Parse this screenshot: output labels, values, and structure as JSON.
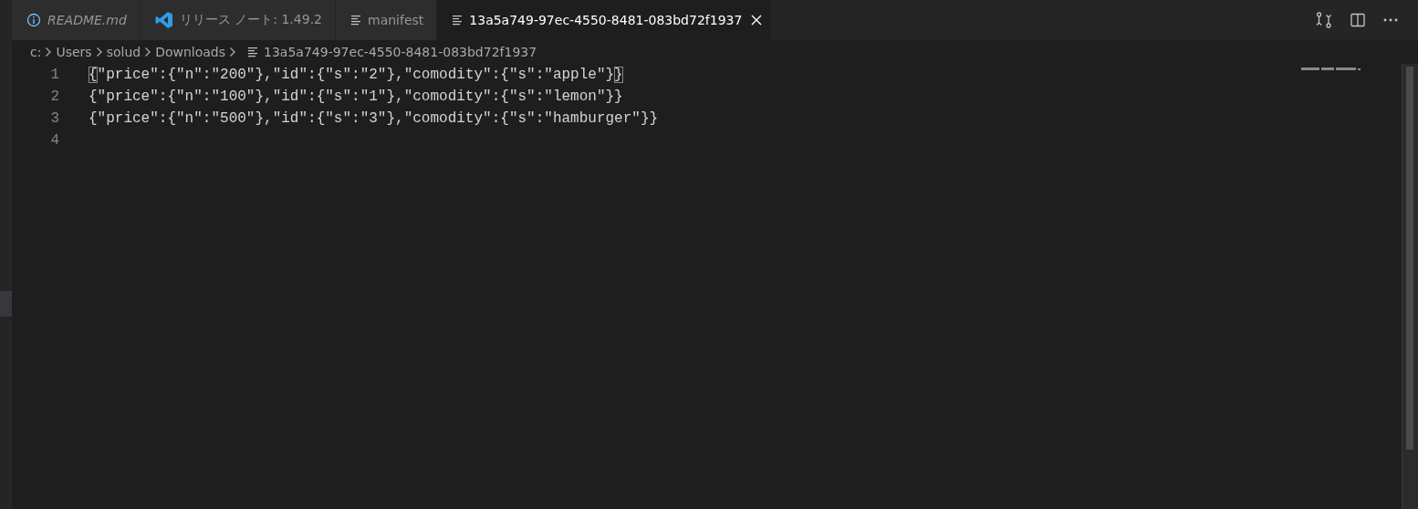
{
  "tabs": [
    {
      "label": "README.md",
      "kind": "info",
      "preview": true,
      "selected": false
    },
    {
      "label": "リリース ノート: 1.49.2",
      "kind": "vscode",
      "preview": false,
      "selected": false
    },
    {
      "label": "manifest",
      "kind": "file",
      "preview": false,
      "selected": false
    },
    {
      "label": "13a5a749-97ec-4550-8481-083bd72f1937",
      "kind": "file",
      "preview": false,
      "selected": true
    }
  ],
  "breadcrumb": [
    {
      "label": "c:",
      "kind": "folder"
    },
    {
      "label": "Users",
      "kind": "folder"
    },
    {
      "label": "solud",
      "kind": "folder"
    },
    {
      "label": "Downloads",
      "kind": "folder"
    },
    {
      "label": "13a5a749-97ec-4550-8481-083bd72f1937",
      "kind": "file"
    }
  ],
  "lines": [
    {
      "number": "1",
      "text": "{\"price\":{\"n\":\"200\"},\"id\":{\"s\":\"2\"},\"comodity\":{\"s\":\"apple\"}}",
      "bracket_match": true
    },
    {
      "number": "2",
      "text": "{\"price\":{\"n\":\"100\"},\"id\":{\"s\":\"1\"},\"comodity\":{\"s\":\"lemon\"}}",
      "bracket_match": false
    },
    {
      "number": "3",
      "text": "{\"price\":{\"n\":\"500\"},\"id\":{\"s\":\"3\"},\"comodity\":{\"s\":\"hamburger\"}}",
      "bracket_match": false
    },
    {
      "number": "4"
    }
  ]
}
